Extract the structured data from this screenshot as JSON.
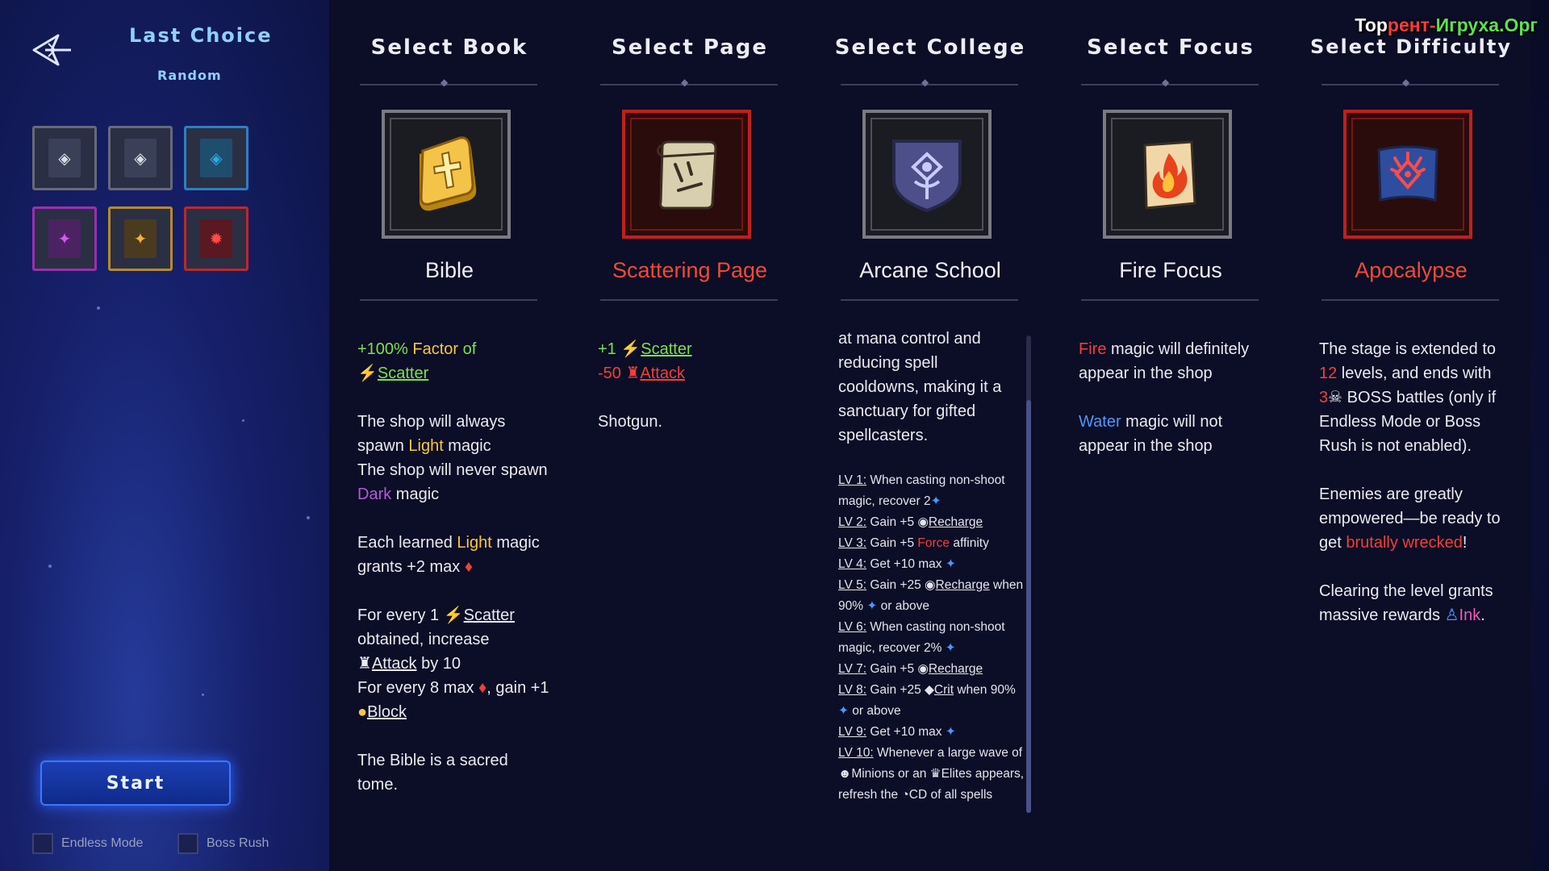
{
  "sidebar": {
    "title": "Last Choice",
    "subtitle": "Random",
    "back_icon": "back-arrow-icon",
    "presets": [
      {
        "icon": "white-diamond-emblem-icon",
        "color": "#d9dde8"
      },
      {
        "icon": "white-diamond-emblem-icon",
        "color": "#d9dde8"
      },
      {
        "icon": "blue-diamond-emblem-icon",
        "color": "#2fa7e0"
      },
      {
        "icon": "purple-emblem-icon",
        "color": "#b53ec9"
      },
      {
        "icon": "gold-emblem-icon",
        "color": "#d99a2b"
      },
      {
        "icon": "red-emblem-icon",
        "color": "#d63030"
      }
    ],
    "start_label": "Start",
    "endless_mode_label": "Endless Mode",
    "boss_rush_label": "Boss Rush"
  },
  "columns": {
    "book": {
      "header": "Select Book",
      "name": "Bible",
      "icon": "golden-bible-icon",
      "desc": {
        "l1a": "+100% ",
        "l1b": "Factor",
        "l1c": " of ",
        "l1d": "Scatter",
        "l2a": "The shop will always spawn ",
        "l2b": "Light",
        "l2c": " magic",
        "l3a": "The shop will never spawn ",
        "l3b": "Dark",
        "l3c": " magic",
        "l4a": "Each learned ",
        "l4b": "Light",
        "l4c": " magic grants +2 max ",
        "l5a": "For every 1 ",
        "l5b": "Scatter",
        "l5c": " obtained, increase ",
        "l5d": "Attack",
        "l5e": " by 10",
        "l6a": "For every 8 max ",
        "l6b": ", gain +1 ",
        "l6c": "Block",
        "l7": "The Bible is a sacred tome."
      }
    },
    "page": {
      "header": "Select Page",
      "name": "Scattering Page",
      "icon": "scroll-page-icon",
      "desc": {
        "l1a": "+1 ",
        "l1b": "Scatter",
        "l2a": "-50 ",
        "l2b": "Attack",
        "l3": "Shotgun."
      }
    },
    "college": {
      "header": "Select College",
      "name": "Arcane School",
      "icon": "arcane-shield-icon",
      "intro": "at mana control and reducing spell cooldowns, making it a sanctuary for gifted spellcasters.",
      "levels": {
        "lv1k": "LV 1:",
        "lv1": " When casting non-shoot magic, recover 2",
        "lv2k": "LV 2:",
        "lv2a": " Gain +5 ",
        "lv2b": "Recharge",
        "lv3k": "LV 3:",
        "lv3a": " Gain +5 ",
        "lv3b": "Force",
        "lv3c": " affinity",
        "lv4k": "LV 4:",
        "lv4": " Get +10 max ",
        "lv5k": "LV 5:",
        "lv5a": " Gain +25 ",
        "lv5b": "Recharge",
        "lv5c": " when 90% ",
        "lv5d": " or above",
        "lv6k": "LV 6:",
        "lv6": " When casting non-shoot magic, recover 2% ",
        "lv7k": "LV 7:",
        "lv7a": " Gain +5 ",
        "lv7b": "Recharge",
        "lv8k": "LV 8:",
        "lv8a": " Gain +25 ",
        "lv8b": "Crit",
        "lv8c": " when 90% ",
        "lv8d": " or above",
        "lv9k": "LV 9:",
        "lv9": " Get +10 max ",
        "lv10k": "LV 10:",
        "lv10a": " Whenever a large wave of ",
        "lv10b": "Minions or an ",
        "lv10c": "Elites appears, refresh the ",
        "lv10d": "CD of all spells"
      }
    },
    "focus": {
      "header": "Select Focus",
      "name": "Fire Focus",
      "icon": "fire-scroll-icon",
      "desc": {
        "l1a": "Fire",
        "l1b": " magic will definitely appear in the shop",
        "l2a": "Water",
        "l2b": " magic will not appear in the shop"
      }
    },
    "difficulty": {
      "header": "Select Difficulty",
      "name": "Apocalypse",
      "icon": "apocalypse-flag-icon",
      "desc": {
        "l1a": "The stage is extended to ",
        "l1b": "12",
        "l1c": " levels, and ends with ",
        "l1d": "3",
        "l1e": " BOSS battles (only if Endless Mode or Boss Rush is not enabled).",
        "l2a": "Enemies are greatly empowered—be ready to get ",
        "l2b": "brutally wrecked",
        "l2c": "!",
        "l3a": "Clearing the level grants massive rewards ",
        "l3b": "Ink",
        "l3c": "."
      }
    }
  },
  "watermark": {
    "a": "Тор",
    "b": "рент-",
    "c": "Игруха.Орг"
  }
}
